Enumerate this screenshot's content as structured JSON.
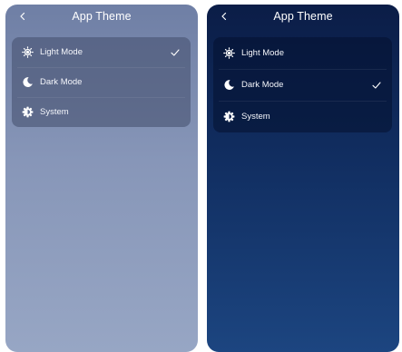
{
  "light_screen": {
    "title": "App Theme",
    "back_icon": "chevron-left-icon",
    "selected": "light",
    "options": [
      {
        "id": "light",
        "label": "Light Mode",
        "icon": "sun-icon"
      },
      {
        "id": "dark",
        "label": "Dark Mode",
        "icon": "moon-icon"
      },
      {
        "id": "system",
        "label": "System",
        "icon": "gear-icon"
      }
    ],
    "colors": {
      "background_top": "#6f7fa5",
      "background_bottom": "#97a6c4"
    }
  },
  "dark_screen": {
    "title": "App Theme",
    "back_icon": "chevron-left-icon",
    "selected": "dark",
    "options": [
      {
        "id": "light",
        "label": "Light Mode",
        "icon": "sun-icon"
      },
      {
        "id": "dark",
        "label": "Dark Mode",
        "icon": "moon-icon"
      },
      {
        "id": "system",
        "label": "System",
        "icon": "gear-icon"
      }
    ],
    "colors": {
      "background_top": "#0b1d47",
      "background_bottom": "#1c4580"
    }
  }
}
